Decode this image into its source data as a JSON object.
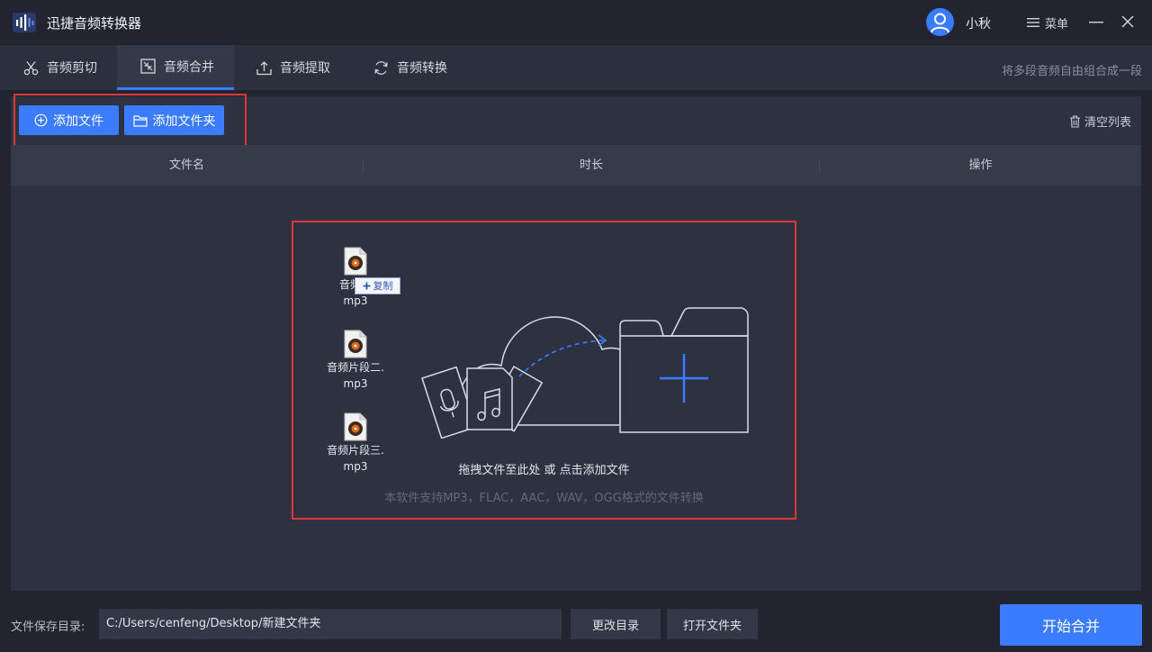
{
  "app": {
    "title": "迅捷音频转换器",
    "logo_icon": "waveform-logo-icon"
  },
  "user": {
    "name": "小秋",
    "avatar_icon": "user-avatar-icon"
  },
  "window": {
    "menu_label": "菜单"
  },
  "tabs": [
    {
      "label": "音频剪切",
      "icon": "scissors-icon",
      "active": false
    },
    {
      "label": "音频合并",
      "icon": "merge-icon",
      "active": true
    },
    {
      "label": "音频提取",
      "icon": "extract-icon",
      "active": false
    },
    {
      "label": "音频转换",
      "icon": "convert-icon",
      "active": false
    }
  ],
  "tab_hint": "将多段音频自由组合成一段",
  "toolbar": {
    "add_file_label": "添加文件",
    "add_folder_label": "添加文件夹",
    "clear_list_label": "清空列表"
  },
  "table": {
    "columns": [
      "文件名",
      "时长",
      "操作"
    ]
  },
  "drop_zone": {
    "title": "拖拽文件至此处 或 点击添加文件",
    "subtitle": "本软件支持MP3，FLAC，AAC，WAV，OGG格式的文件转换",
    "files": [
      {
        "name_line1": "音频片",
        "name_line2": "mp3"
      },
      {
        "name_line1": "音频片段二.",
        "name_line2": "mp3"
      },
      {
        "name_line1": "音频片段三.",
        "name_line2": "mp3"
      }
    ],
    "copy_label": "复制"
  },
  "bottom": {
    "save_dir_label": "文件保存目录:",
    "save_path": "C:/Users/cenfeng/Desktop/新建文件夹",
    "change_dir_label": "更改目录",
    "open_folder_label": "打开文件夹",
    "start_label": "开始合并"
  },
  "colors": {
    "accent": "#3b7cff",
    "highlight": "#e03838",
    "background": "#22252f"
  }
}
